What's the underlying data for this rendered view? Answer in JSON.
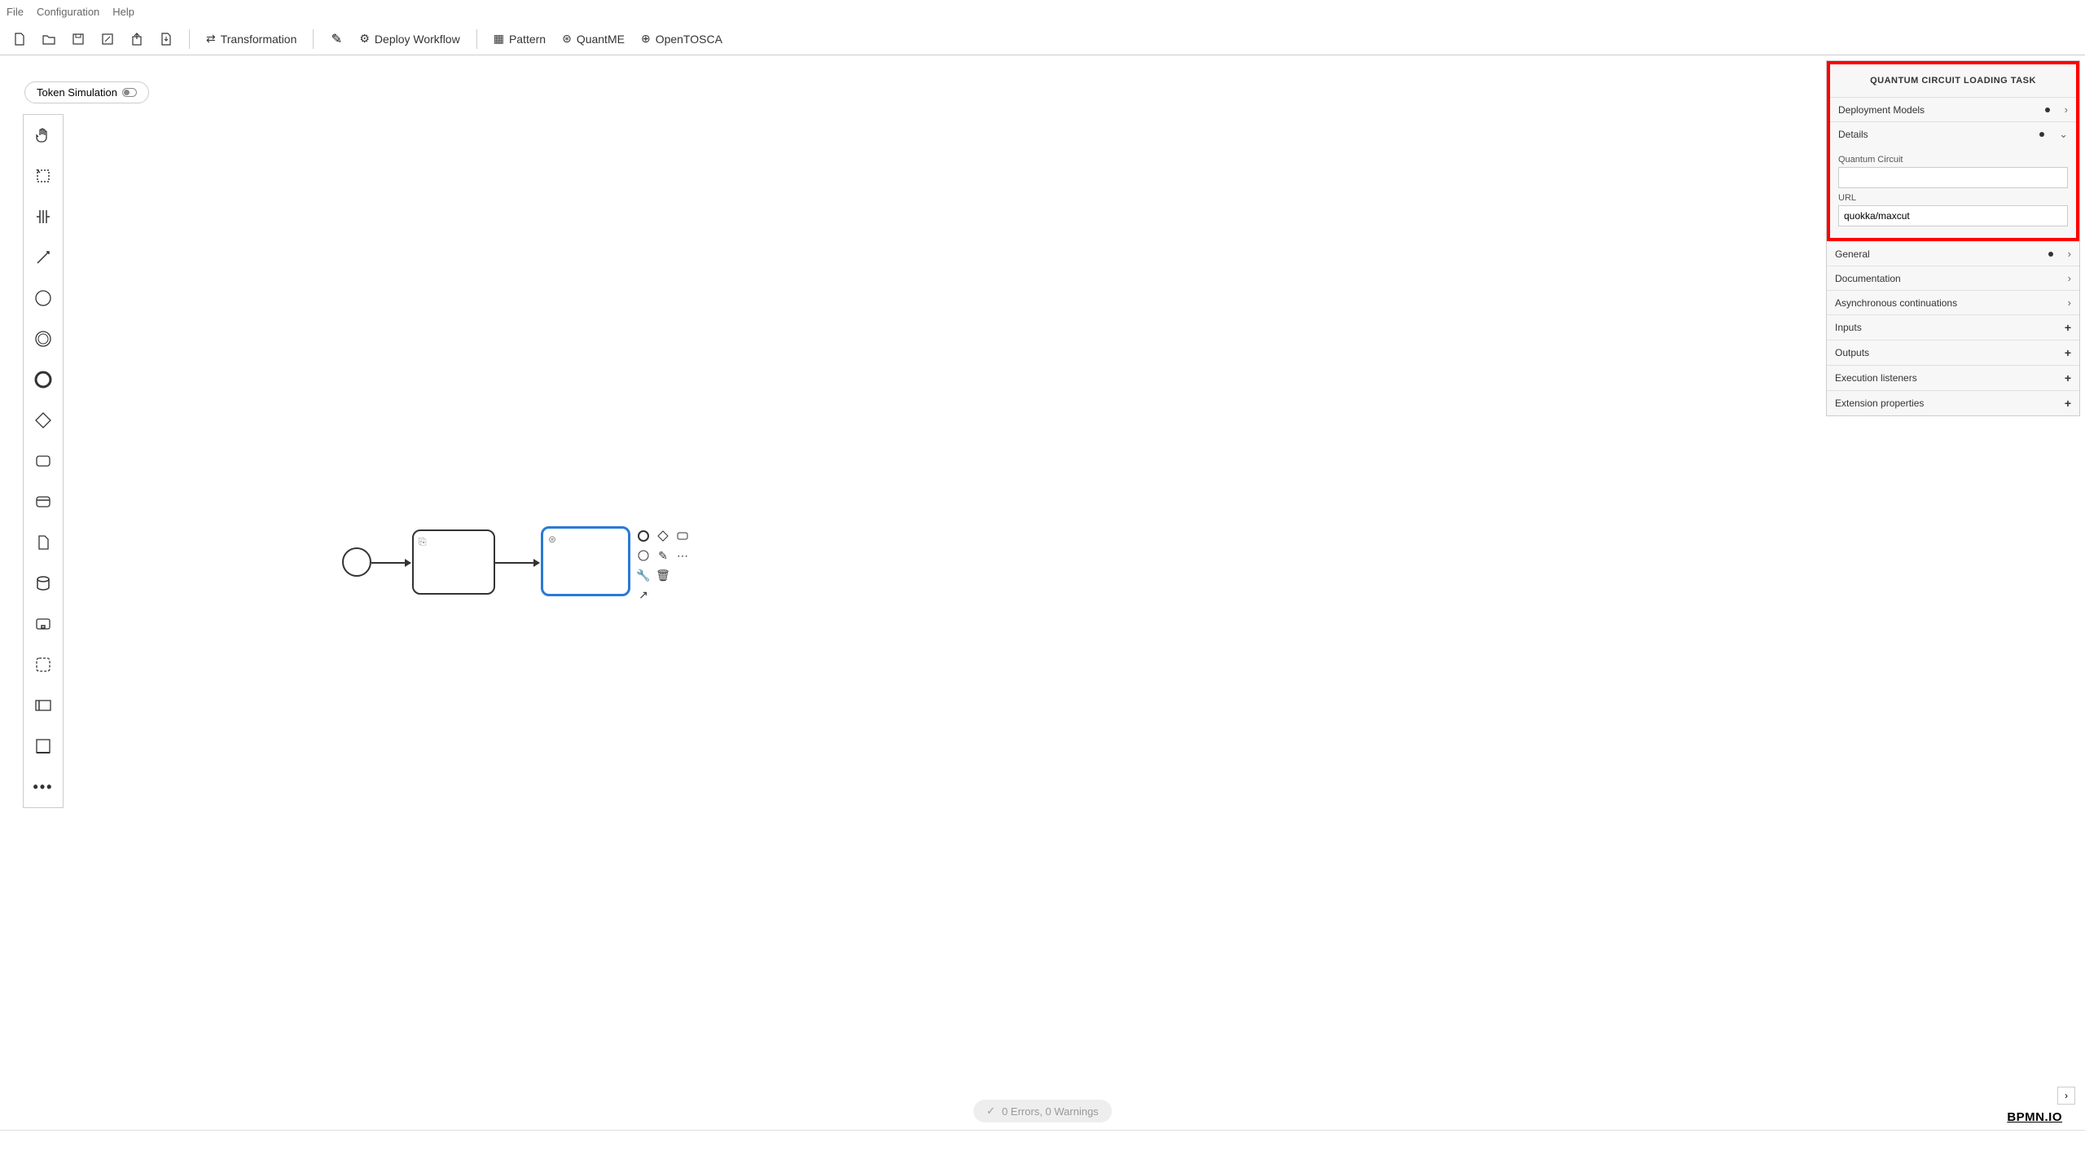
{
  "menu": {
    "file": "File",
    "config": "Configuration",
    "help": "Help"
  },
  "toolbar": {
    "transformation": "Transformation",
    "deploy": "Deploy Workflow",
    "pattern": "Pattern",
    "quantme": "QuantME",
    "opentosca": "OpenTOSCA"
  },
  "token_sim": "Token Simulation",
  "status": {
    "text": "0 Errors, 0 Warnings"
  },
  "props": {
    "title": "QUANTUM CIRCUIT LOADING TASK",
    "deployment": "Deployment Models",
    "details": "Details",
    "qc_label": "Quantum Circuit",
    "qc_value": "",
    "url_label": "URL",
    "url_value": "quokka/maxcut",
    "general": "General",
    "documentation": "Documentation",
    "async": "Asynchronous continuations",
    "inputs": "Inputs",
    "outputs": "Outputs",
    "exec": "Execution listeners",
    "ext": "Extension properties"
  },
  "bpmnio": "BPMN.IO"
}
